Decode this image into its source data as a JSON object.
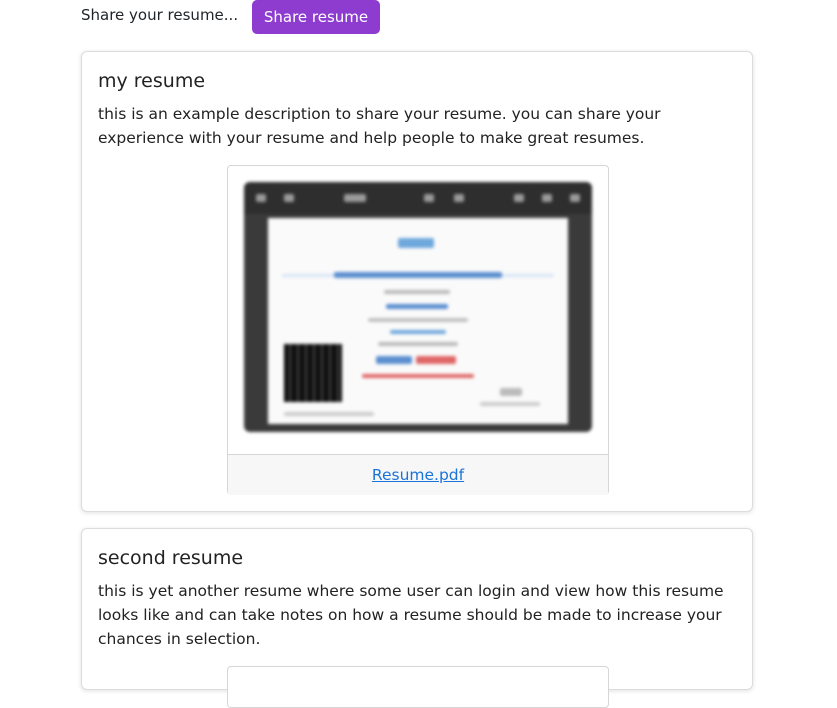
{
  "header": {
    "prompt_text": "Share your resume...",
    "share_button_label": "Share resume"
  },
  "resumes": [
    {
      "title": "my resume",
      "description": "this is an example description to share your resume. you can share your experience with your resume and help people to make great resumes.",
      "file_name": "Resume.pdf"
    },
    {
      "title": "second resume",
      "description": "this is yet another resume where some user can login and view how this resume looks like and can take notes on how a resume should be made to increase your chances in selection."
    }
  ],
  "colors": {
    "accent_button": "#8e3bd0",
    "link": "#1a73d9"
  }
}
